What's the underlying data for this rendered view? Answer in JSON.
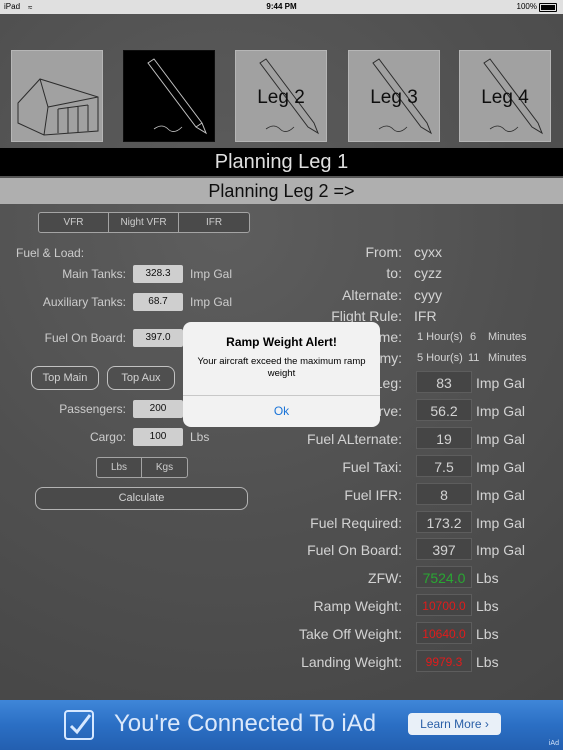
{
  "status_bar": {
    "carrier": "iPad",
    "time": "9:44 PM",
    "battery": "100%"
  },
  "leg_tiles": [
    {
      "label": ""
    },
    {
      "label": ""
    },
    {
      "label": "Leg 2"
    },
    {
      "label": "Leg 3"
    },
    {
      "label": "Leg 4"
    }
  ],
  "header": {
    "title": "Planning Leg 1",
    "next_leg": "Planning Leg 2 =>"
  },
  "flight_type": [
    "VFR",
    "Night VFR",
    "IFR"
  ],
  "left": {
    "section": "Fuel & Load:",
    "main_tanks_label": "Main Tanks:",
    "main_tanks_value": "328.3",
    "main_tanks_unit": "Imp Gal",
    "aux_tanks_label": "Auxiliary Tanks:",
    "aux_tanks_value": "68.7",
    "aux_tanks_unit": "Imp Gal",
    "fuel_on_board_label": "Fuel On Board:",
    "fuel_on_board_value": "397.0",
    "top_main": "Top Main",
    "top_aux": "Top Aux",
    "passengers_label": "Passengers:",
    "passengers_value": "200",
    "cargo_label": "Cargo:",
    "cargo_value": "100",
    "cargo_unit": "Lbs",
    "units": [
      "Lbs",
      "Kgs"
    ],
    "calculate": "Calculate"
  },
  "right": {
    "from_label": "From:",
    "from_value": "cyxx",
    "to_label": "to:",
    "to_value": "cyzz",
    "alternate_label": "Alternate:",
    "alternate_value": "cyyy",
    "flight_rule_label": "Flight Rule:",
    "flight_rule_value": "IFR",
    "time_label": "me:",
    "time_hours": "1 Hour(s)",
    "time_minutes_value": "6",
    "time_minutes_unit": "Minutes",
    "time2_label": "my:",
    "time2_hours": "5 Hour(s)",
    "time2_minutes_value": "11",
    "time2_minutes_unit": "Minutes",
    "leg_label": "Leg:",
    "leg_value": "83",
    "leg_unit": "Imp Gal",
    "reserve_label": "rve:",
    "reserve_value": "56.2",
    "reserve_unit": "Imp Gal",
    "fuel_alternate_label": "Fuel ALternate:",
    "fuel_alternate_value": "19",
    "fuel_alternate_unit": "Imp Gal",
    "fuel_taxi_label": "Fuel Taxi:",
    "fuel_taxi_value": "7.5",
    "fuel_taxi_unit": "Imp Gal",
    "fuel_ifr_label": "Fuel IFR:",
    "fuel_ifr_value": "8",
    "fuel_ifr_unit": "Imp Gal",
    "fuel_required_label": "Fuel Required:",
    "fuel_required_value": "173.2",
    "fuel_required_unit": "Imp Gal",
    "fuel_on_board_label": "Fuel On Board:",
    "fuel_on_board_value": "397",
    "fuel_on_board_unit": "Imp Gal",
    "zfw_label": "ZFW:",
    "zfw_value": "7524.0",
    "zfw_unit": "Lbs",
    "ramp_weight_label": "Ramp Weight:",
    "ramp_weight_value": "10700.0",
    "ramp_weight_unit": "Lbs",
    "takeoff_weight_label": "Take Off Weight:",
    "takeoff_weight_value": "10640.0",
    "takeoff_weight_unit": "Lbs",
    "landing_weight_label": "Landing Weight:",
    "landing_weight_value": "9979.3",
    "landing_weight_unit": "Lbs"
  },
  "alert": {
    "title": "Ramp Weight Alert!",
    "message": "Your aircraft exceed the maximum ramp weight",
    "ok": "Ok"
  },
  "ad": {
    "text": "You're Connected To iAd",
    "button": "Learn More ›",
    "mark": "iAd"
  },
  "colors": {
    "ok_button": "#1a74d8",
    "zfw": "#2fbf3a",
    "weight_alert": "#ff2020",
    "ad_banner": "#2b6fc4"
  }
}
